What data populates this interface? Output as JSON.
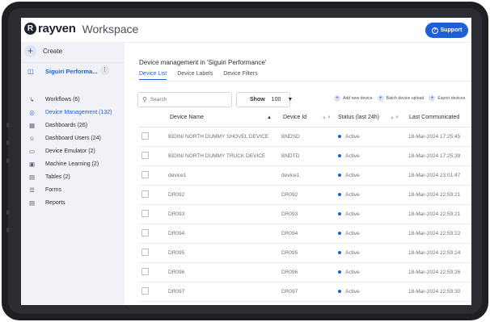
{
  "app": {
    "logo_mark": "R",
    "logo_text": "rayven",
    "workspace_label": "Workspace",
    "support_label": "Support"
  },
  "sidebar": {
    "create_label": "Create",
    "project_name": "Siguiri Performa...",
    "items": [
      {
        "label": "Workflows (6)",
        "icon": "workflow-icon"
      },
      {
        "label": "Device Management (132)",
        "icon": "device-icon"
      },
      {
        "label": "Dashboards (26)",
        "icon": "dashboard-icon"
      },
      {
        "label": "Dashboard Users (24)",
        "icon": "users-icon"
      },
      {
        "label": "Device Emulator (2)",
        "icon": "emulator-icon"
      },
      {
        "label": "Machine Learning (2)",
        "icon": "ml-icon"
      },
      {
        "label": "Tables (2)",
        "icon": "table-icon"
      },
      {
        "label": "Forms",
        "icon": "form-icon"
      },
      {
        "label": "Reports",
        "icon": "report-icon"
      }
    ]
  },
  "main": {
    "title": "Device management in 'Siguiri Performance'",
    "tabs": [
      "Device List",
      "Device Labels",
      "Device Filters"
    ],
    "search_placeholder": "Search",
    "show_label": "Show",
    "show_value": "100",
    "actions": [
      "Add new device",
      "Batch device upload",
      "Export devices"
    ]
  },
  "table": {
    "columns": [
      "Device Name",
      "Device Id",
      "Status (last 24h)",
      "Last Communicated"
    ],
    "rows": [
      {
        "name": "BIDINI NORTH DUMMY SHOVEL DEVICE",
        "id": "BNDSD",
        "status": "Active",
        "last": "18-Mar-2024 17:25:45"
      },
      {
        "name": "BIDINI NORTH DUMMY TRUCK DEVICE",
        "id": "BNDTD",
        "status": "Active",
        "last": "18-Mar-2024 17:25:39"
      },
      {
        "name": "device1",
        "id": "device1",
        "status": "Active",
        "last": "18-Mar-2024 23:01:47"
      },
      {
        "name": "DR092",
        "id": "DR092",
        "status": "Active",
        "last": "18-Mar-2024 22:59:21"
      },
      {
        "name": "DR093",
        "id": "DR093",
        "status": "Active",
        "last": "18-Mar-2024 22:59:21"
      },
      {
        "name": "DR094",
        "id": "DR094",
        "status": "Active",
        "last": "18-Mar-2024 22:59:22"
      },
      {
        "name": "DR095",
        "id": "DR095",
        "status": "Active",
        "last": "18-Mar-2024 22:59:24"
      },
      {
        "name": "DR096",
        "id": "DR096",
        "status": "Active",
        "last": "18-Mar-2024 22:59:26"
      },
      {
        "name": "DR097",
        "id": "DR097",
        "status": "Active",
        "last": "18-Mar-2024 22:59:30"
      }
    ]
  },
  "colors": {
    "accent": "#1e5fd8",
    "sidebar_bg": "#f0f2f7",
    "status_active": "#1e5fd8"
  }
}
